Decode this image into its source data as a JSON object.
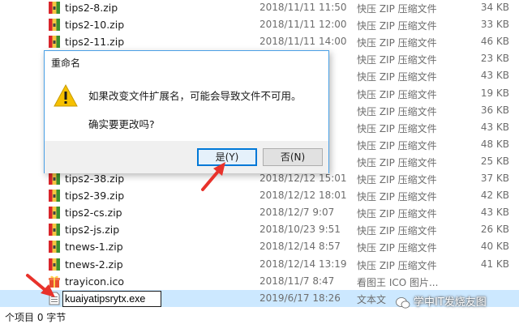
{
  "files": [
    {
      "name": "tips2-8.zip",
      "date": "2018/11/11 11:50",
      "type": "快压 ZIP 压缩文件",
      "size": "34 KB",
      "icon": "zip-icon"
    },
    {
      "name": "tips2-10.zip",
      "date": "2018/11/11 12:00",
      "type": "快压 ZIP 压缩文件",
      "size": "33 KB",
      "icon": "zip-icon"
    },
    {
      "name": "tips2-11.zip",
      "date": "2018/11/11 14:00",
      "type": "快压 ZIP 压缩文件",
      "size": "46 KB",
      "icon": "zip-icon"
    },
    {
      "name": "",
      "date": "",
      "type": "快压 ZIP 压缩文件",
      "size": "23 KB",
      "icon": "zip-icon"
    },
    {
      "name": "",
      "date": "5",
      "type": "快压 ZIP 压缩文件",
      "size": "43 KB",
      "icon": "zip-icon"
    },
    {
      "name": "",
      "date": "",
      "type": "快压 ZIP 压缩文件",
      "size": "19 KB",
      "icon": "zip-icon"
    },
    {
      "name": "",
      "date": "",
      "type": "快压 ZIP 压缩文件",
      "size": "36 KB",
      "icon": "zip-icon"
    },
    {
      "name": "",
      "date": "6",
      "type": "快压 ZIP 压缩文件",
      "size": "43 KB",
      "icon": "zip-icon"
    },
    {
      "name": "",
      "date": "",
      "type": "快压 ZIP 压缩文件",
      "size": "48 KB",
      "icon": "zip-icon"
    },
    {
      "name": "",
      "date": "1",
      "type": "快压 ZIP 压缩文件",
      "size": "25 KB",
      "icon": "zip-icon"
    },
    {
      "name": "tips2-38.zip",
      "date": "2018/12/12 15:01",
      "type": "快压 ZIP 压缩文件",
      "size": "37 KB",
      "icon": "zip-icon"
    },
    {
      "name": "tips2-39.zip",
      "date": "2018/12/12 18:01",
      "type": "快压 ZIP 压缩文件",
      "size": "42 KB",
      "icon": "zip-icon"
    },
    {
      "name": "tips2-cs.zip",
      "date": "2018/12/7 9:07",
      "type": "快压 ZIP 压缩文件",
      "size": "43 KB",
      "icon": "zip-icon"
    },
    {
      "name": "tips2-js.zip",
      "date": "2018/10/23 9:51",
      "type": "快压 ZIP 压缩文件",
      "size": "26 KB",
      "icon": "zip-icon"
    },
    {
      "name": "tnews-1.zip",
      "date": "2018/12/14 8:57",
      "type": "快压 ZIP 压缩文件",
      "size": "40 KB",
      "icon": "zip-icon"
    },
    {
      "name": "tnews-2.zip",
      "date": "2018/12/14 13:19",
      "type": "快压 ZIP 压缩文件",
      "size": "41 KB",
      "icon": "zip-icon"
    },
    {
      "name": "trayicon.ico",
      "date": "2018/11/7 8:47",
      "type": "看图王 ICO 图片...",
      "size": "",
      "icon": "gift-icon"
    },
    {
      "name": "",
      "date": "2019/6/17 18:26",
      "type": "文本文",
      "size": "",
      "icon": "text-file-icon",
      "selected": true
    }
  ],
  "rename_value": "kuaiyatipsrytx.exe",
  "status": {
    "count": "个项目  0 字节"
  },
  "dialog": {
    "title": "重命名",
    "line1": "如果改变文件扩展名，可能会导致文件不可用。",
    "line2": "确实要更改吗?",
    "yes_label": "是(Y)",
    "no_label": "否(N)"
  },
  "watermark": {
    "text": "学中IT发烧友图"
  },
  "colors": {
    "accent": "#0078d7",
    "selection": "#cce8ff",
    "arrow": "#e8322b",
    "warning": "#f6c000"
  }
}
